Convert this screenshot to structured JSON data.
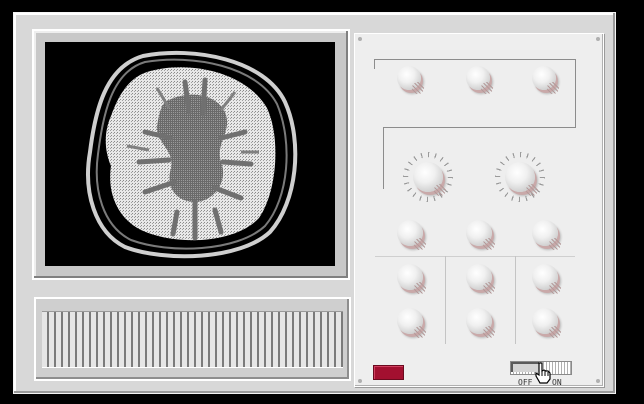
{
  "window": {
    "title": ""
  },
  "monitor": {
    "image_description_name": "brain-mri-scan"
  },
  "control_panel": {
    "top_row_labels": [
      "",
      "",
      ""
    ],
    "group_labels": [
      "",
      ""
    ],
    "power_label": "",
    "switch": {
      "off_label": "OFF",
      "on_label": "ON",
      "state": "off"
    }
  },
  "colors": {
    "cabinet": "#d8d8d8",
    "panel": "#eeeeee",
    "power_lamp": "#a31030",
    "screen": "#000000"
  }
}
